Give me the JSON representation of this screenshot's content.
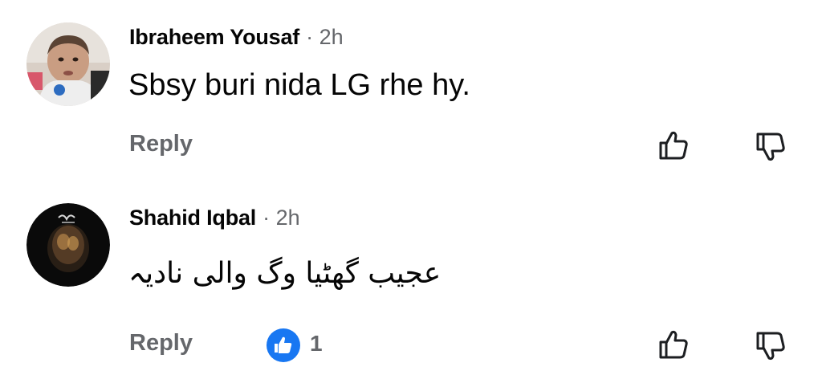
{
  "comments": [
    {
      "author": "Ibraheem Yousaf",
      "time": "· 2h",
      "text": "Sbsy buri nida LG rhe hy.",
      "reply_label": "Reply",
      "avatar_icon": "baby-photo-avatar"
    },
    {
      "author": "Shahid Iqbal",
      "time": "· 2h",
      "text": "عجیب گھٹیا وگ والی نادیہ",
      "reply_label": "Reply",
      "reaction": {
        "icon": "like-reaction-icon",
        "count": "1",
        "color": "#1877f2"
      },
      "avatar_icon": "prayer-hands-avatar"
    }
  ],
  "icons": {
    "like": "thumbs-up-icon",
    "dislike": "thumbs-down-icon"
  },
  "colors": {
    "secondary_text": "#65676b",
    "primary_text": "#050505",
    "like_blue": "#1877f2"
  }
}
